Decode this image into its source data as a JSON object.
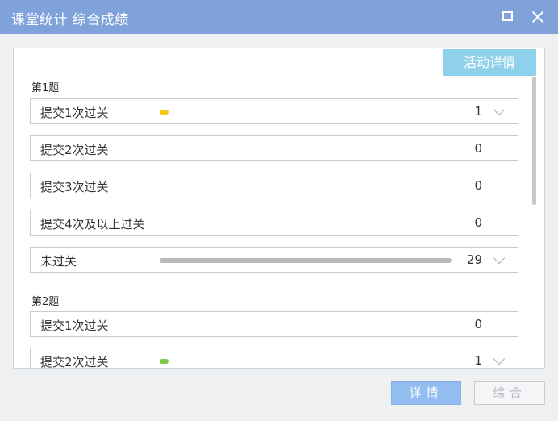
{
  "window": {
    "title": "课堂统计 综合成绩"
  },
  "panel": {
    "activity_button": "活动详情",
    "questions": [
      {
        "label": "第1题",
        "rows": [
          {
            "label": "提交1次过关",
            "count": "1",
            "expandable": true,
            "bar_color": "#f2c811",
            "bar_fraction": 0.03
          },
          {
            "label": "提交2次过关",
            "count": "0",
            "expandable": false
          },
          {
            "label": "提交3次过关",
            "count": "0",
            "expandable": false
          },
          {
            "label": "提交4次及以上过关",
            "count": "0",
            "expandable": false
          },
          {
            "label": "未过关",
            "count": "29",
            "expandable": true,
            "bar_color": "#b9b9b9",
            "bar_fraction": 0.97
          }
        ]
      },
      {
        "label": "第2题",
        "rows": [
          {
            "label": "提交1次过关",
            "count": "0",
            "expandable": false
          },
          {
            "label": "提交2次过关",
            "count": "1",
            "expandable": true,
            "bar_color": "#7ac943",
            "bar_fraction": 0.03
          }
        ]
      }
    ]
  },
  "footer": {
    "detail_button": "详情",
    "overall_button": "综合"
  }
}
